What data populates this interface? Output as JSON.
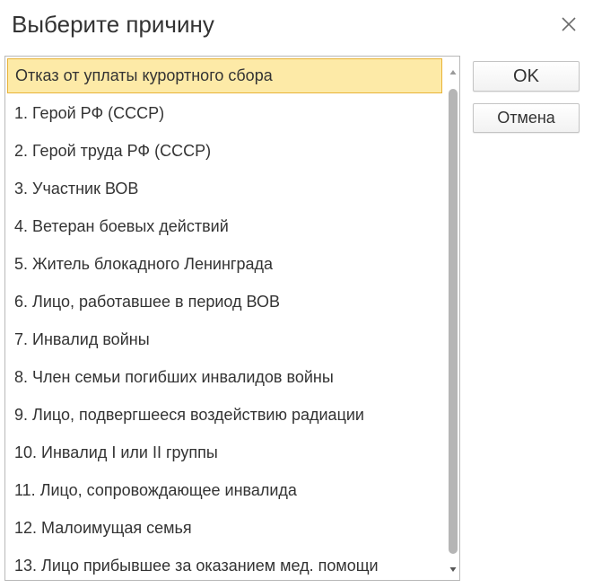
{
  "dialog": {
    "title": "Выберите причину",
    "close_icon": "close-icon"
  },
  "list": {
    "selected_index": 0,
    "items": [
      {
        "label": "Отказ от уплаты курортного сбора"
      },
      {
        "label": "1. Герой РФ (СССР)"
      },
      {
        "label": "2. Герой труда РФ (СССР)"
      },
      {
        "label": "3. Участник ВОВ"
      },
      {
        "label": "4. Ветеран боевых действий"
      },
      {
        "label": "5. Житель блокадного Ленинграда"
      },
      {
        "label": "6. Лицо, работавшее в период ВОВ"
      },
      {
        "label": "7. Инвалид войны"
      },
      {
        "label": "8. Член семьи погибших инвалидов войны"
      },
      {
        "label": "9. Лицо, подвергшееся воздействию радиации"
      },
      {
        "label": "10. Инвалид I или II группы"
      },
      {
        "label": "11. Лицо, сопровождающее инвалида"
      },
      {
        "label": "12. Малоимущая семья"
      },
      {
        "label": "13. Лицо прибывшее за оказанием мед. помощи"
      }
    ]
  },
  "buttons": {
    "ok_label": "OK",
    "cancel_label": "Отмена"
  },
  "colors": {
    "selection_fill": "#fdeaa7",
    "selection_border": "#e8b339",
    "scroll_thumb": "#b5b5b5"
  }
}
